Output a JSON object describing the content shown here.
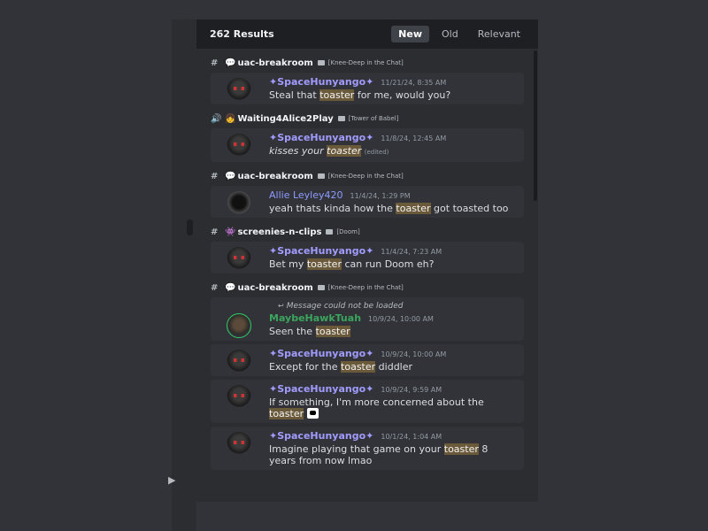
{
  "panel": {
    "results_count": "262 Results",
    "sort_tabs": [
      "New",
      "Old",
      "Relevant"
    ]
  },
  "groups": [
    {
      "channel": {
        "icon": "#",
        "emoji": "💬",
        "name": "uac-breakroom",
        "category": "[Knee-Deep in the Chat]"
      },
      "messages": [
        {
          "author": "✦SpaceHunyango✦",
          "time": "11/21/24, 8:35 AM",
          "pre": "Steal that ",
          "hl": "toaster",
          "post": " for me, would you?"
        }
      ]
    },
    {
      "channel": {
        "icon": "🔊",
        "emoji": "👧",
        "name": "Waiting4Alice2Play",
        "category": "[Tower of Babel]"
      },
      "messages": [
        {
          "author": "✦SpaceHunyango✦",
          "time": "11/8/24, 12:45 AM",
          "pre": "kisses your ",
          "hl": "toaster",
          "post": "",
          "edited": "(edited)"
        }
      ]
    },
    {
      "channel": {
        "icon": "#",
        "emoji": "💬",
        "name": "uac-breakroom",
        "category": "[Knee-Deep in the Chat]"
      },
      "messages": [
        {
          "author": "Allie Leyley420",
          "time": "11/4/24, 1:29 PM",
          "pre": "yeah thats kinda how the ",
          "hl": "toaster",
          "post": " got toasted too"
        }
      ]
    },
    {
      "channel": {
        "icon": "#",
        "emoji": "👾",
        "name": "screenies-n-clips",
        "category": "[Doom]"
      },
      "messages": [
        {
          "author": "✦SpaceHunyango✦",
          "time": "11/4/24, 7:23 AM",
          "pre": "Bet my ",
          "hl": "toaster",
          "post": " can run Doom eh?"
        }
      ]
    },
    {
      "channel": {
        "icon": "#",
        "emoji": "💬",
        "name": "uac-breakroom",
        "category": "[Knee-Deep in the Chat]"
      },
      "messages": [
        {
          "reply": "Message could not be loaded",
          "author": "MaybeHawkTuah",
          "time": "10/9/24, 10:00 AM",
          "pre": "Seen the ",
          "hl": "toaster",
          "post": ""
        },
        {
          "author": "✦SpaceHunyango✦",
          "time": "10/9/24, 10:00 AM",
          "pre": "Except for the ",
          "hl": "toaster",
          "post": " diddler"
        },
        {
          "author": "✦SpaceHunyango✦",
          "time": "10/9/24, 9:59 AM",
          "pre": "If something, I'm more concerned about the ",
          "hl": "toaster",
          "post": ""
        },
        {
          "author": "✦SpaceHunyango✦",
          "time": "10/1/24, 1:04 AM",
          "pre": "Imagine playing that game on your ",
          "hl": "toaster",
          "post": " 8 years from now lmao"
        }
      ]
    }
  ]
}
